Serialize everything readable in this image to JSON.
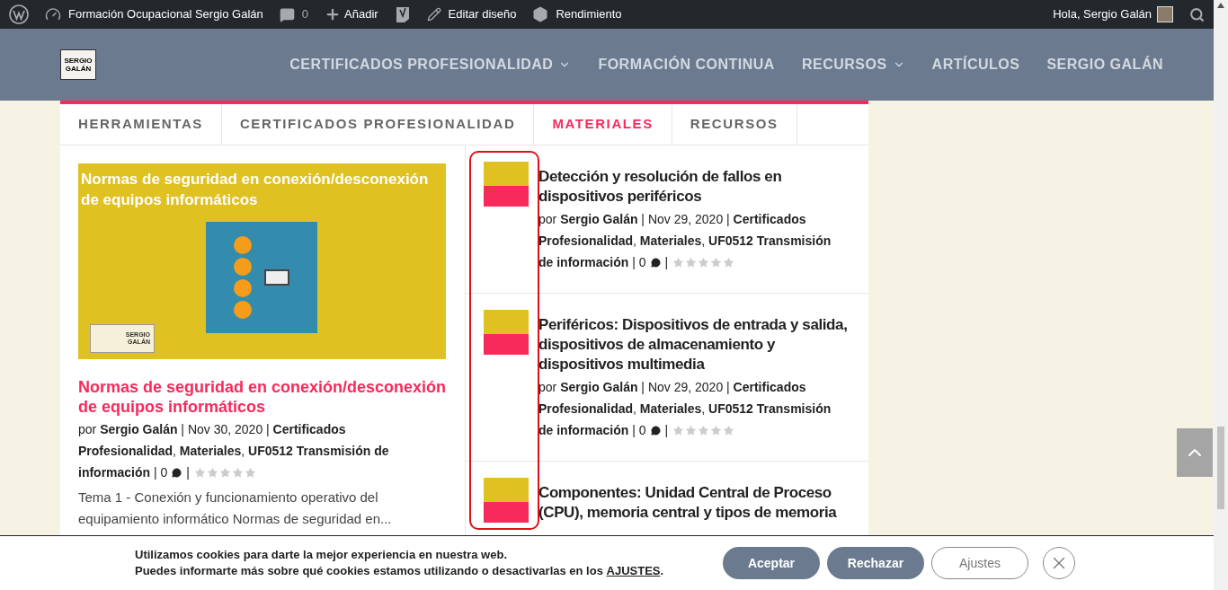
{
  "admin_bar": {
    "items": [
      {
        "kind": "wp"
      },
      {
        "kind": "site",
        "label": "Formación Ocupacional Sergio Galán"
      },
      {
        "kind": "comments",
        "label": "0"
      },
      {
        "kind": "new",
        "label": "Añadir"
      },
      {
        "kind": "seo"
      },
      {
        "kind": "edit",
        "label": "Editar diseño"
      },
      {
        "kind": "performance",
        "label": "Rendimiento"
      }
    ],
    "greeting": "Hola, Sergio Galán"
  },
  "header": {
    "logo": [
      "SERGIO",
      "GALÁN"
    ],
    "nav": [
      {
        "label": "CERTIFICADOS PROFESIONALIDAD",
        "dropdown": true
      },
      {
        "label": "FORMACIÓN CONTINUA",
        "dropdown": false
      },
      {
        "label": "RECURSOS",
        "dropdown": true
      },
      {
        "label": "ARTÍCULOS",
        "dropdown": false
      },
      {
        "label": "SERGIO GALÁN",
        "dropdown": false
      }
    ]
  },
  "tabs": [
    {
      "label": "HERRAMIENTAS",
      "selected": false
    },
    {
      "label": "CERTIFICADOS PROFESIONALIDAD",
      "selected": false
    },
    {
      "label": "MATERIALES",
      "selected": true
    },
    {
      "label": "RECURSOS",
      "selected": false
    }
  ],
  "featured": {
    "image_caption": "Normas de seguridad en conexión/desconexión de equipos informáticos",
    "image_logo": [
      "SERGIO",
      "GALÁN"
    ],
    "title": "Normas de seguridad en conexión/desconexión de equipos informáticos",
    "meta_lines": [
      "por **Sergio Galán** | Nov 30, 2020 | **Certificados**",
      "**Profesionalidad**, **Materiales**, **UF0512 Transmisión de**",
      "**información** | 0"
    ],
    "separator": "|",
    "stars": 0,
    "excerpt": "Tema 1 - Conexión y funcionamiento operativo del equipamiento informático Normas de seguridad en..."
  },
  "posts": [
    {
      "title": "Detección y resolución de fallos en dispositivos periféricos",
      "meta_lines": [
        "por **Sergio Galán** | Nov 29, 2020 | **Certificados**",
        "**Profesionalidad**, **Materiales**, **UF0512 Transmisión**",
        "**de información** | 0"
      ],
      "separator": "|",
      "stars": 0
    },
    {
      "title": "Periféricos: Dispositivos de entrada y salida, dispositivos de almacenamiento y dispositivos multimedia",
      "meta_lines": [
        "por **Sergio Galán** | Nov 29, 2020 | **Certificados**",
        "**Profesionalidad**, **Materiales**, **UF0512 Transmisión**",
        "**de información** | 0"
      ],
      "separator": "|",
      "stars": 0
    },
    {
      "title": "Componentes: Unidad Central de Proceso (CPU), memoria central y tipos de memoria"
    }
  ],
  "cookie": {
    "line_1": "Utilizamos cookies para darte la mejor experiencia en nuestra web.",
    "line_2": "Puedes informarte más sobre qué cookies estamos utilizando o desactivarlas en los",
    "link": "AJUSTES",
    "link_end": ".",
    "buttons": [
      {
        "label": "Aceptar",
        "kind": "filled"
      },
      {
        "label": "Rechazar",
        "kind": "filled"
      },
      {
        "label": "Ajustes",
        "kind": "outline"
      }
    ]
  }
}
